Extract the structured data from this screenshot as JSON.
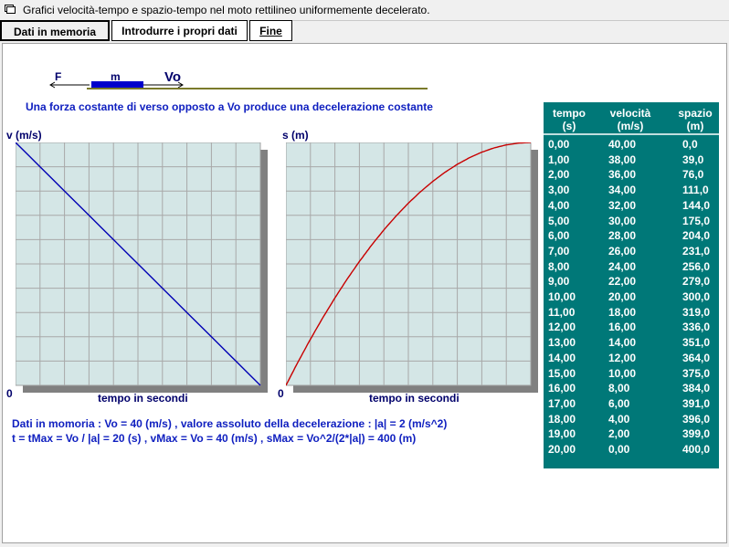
{
  "window": {
    "title": "Grafici velocità-tempo e spazio-tempo nel moto rettilineo uniformemente decelerato."
  },
  "menu": {
    "data_label": "Dati in memoria",
    "input_label": "Introdurre i propri dati",
    "end_label": "Fine"
  },
  "diagram": {
    "force_label": "F",
    "mass_label": "m",
    "velocity_label": "Vo"
  },
  "description": "Una forza costante di verso opposto a Vo produce una decelerazione costante",
  "velocity_chart": {
    "ylabel": "v (m/s)",
    "xlabel": "tempo in secondi",
    "origin": "0"
  },
  "space_chart": {
    "ylabel": "s (m)",
    "xlabel": "tempo in secondi",
    "origin": "0"
  },
  "chart_data": [
    {
      "type": "line",
      "ylabel": "v (m/s)",
      "xlabel": "tempo in secondi",
      "xlim": [
        0,
        20
      ],
      "ylim": [
        0,
        40
      ],
      "grid": true,
      "x": [
        0,
        1,
        2,
        3,
        4,
        5,
        6,
        7,
        8,
        9,
        10,
        11,
        12,
        13,
        14,
        15,
        16,
        17,
        18,
        19,
        20
      ],
      "y": [
        40,
        38,
        36,
        34,
        32,
        30,
        28,
        26,
        24,
        22,
        20,
        18,
        16,
        14,
        12,
        10,
        8,
        6,
        4,
        2,
        0
      ],
      "color": "#0000b4"
    },
    {
      "type": "line",
      "ylabel": "s (m)",
      "xlabel": "tempo in secondi",
      "xlim": [
        0,
        20
      ],
      "ylim": [
        0,
        400
      ],
      "grid": true,
      "x": [
        0,
        1,
        2,
        3,
        4,
        5,
        6,
        7,
        8,
        9,
        10,
        11,
        12,
        13,
        14,
        15,
        16,
        17,
        18,
        19,
        20
      ],
      "y": [
        0,
        39,
        76,
        111,
        144,
        175,
        204,
        231,
        256,
        279,
        300,
        319,
        336,
        351,
        364,
        375,
        384,
        391,
        396,
        399,
        400
      ],
      "color": "#c80000"
    }
  ],
  "table": {
    "headers": [
      [
        "tempo",
        "(s)"
      ],
      [
        "velocità",
        "(m/s)"
      ],
      [
        "spazio",
        "(m)"
      ]
    ],
    "rows": [
      [
        "0,00",
        "40,00",
        "0,0"
      ],
      [
        "1,00",
        "38,00",
        "39,0"
      ],
      [
        "2,00",
        "36,00",
        "76,0"
      ],
      [
        "3,00",
        "34,00",
        "111,0"
      ],
      [
        "4,00",
        "32,00",
        "144,0"
      ],
      [
        "5,00",
        "30,00",
        "175,0"
      ],
      [
        "6,00",
        "28,00",
        "204,0"
      ],
      [
        "7,00",
        "26,00",
        "231,0"
      ],
      [
        "8,00",
        "24,00",
        "256,0"
      ],
      [
        "9,00",
        "22,00",
        "279,0"
      ],
      [
        "10,00",
        "20,00",
        "300,0"
      ],
      [
        "11,00",
        "18,00",
        "319,0"
      ],
      [
        "12,00",
        "16,00",
        "336,0"
      ],
      [
        "13,00",
        "14,00",
        "351,0"
      ],
      [
        "14,00",
        "12,00",
        "364,0"
      ],
      [
        "15,00",
        "10,00",
        "375,0"
      ],
      [
        "16,00",
        "8,00",
        "384,0"
      ],
      [
        "17,00",
        "6,00",
        "391,0"
      ],
      [
        "18,00",
        "4,00",
        "396,0"
      ],
      [
        "19,00",
        "2,00",
        "399,0"
      ],
      [
        "20,00",
        "0,00",
        "400,0"
      ]
    ]
  },
  "info": {
    "line1": "Dati in momoria : Vo = 40 (m/s) , valore assoluto della decelerazione : |a| = 2 (m/s^2)",
    "line2": "t = tMax = Vo / |a| = 20 (s) , vMax = Vo = 40 (m/s) , sMax = Vo^2/(2*|a|) = 400 (m)"
  },
  "colors": {
    "table_bg": "#007878",
    "plot_bg": "#d4e6e6",
    "text_blue": "#1020c0",
    "velocity_line": "#0000b4",
    "space_line": "#c80000"
  }
}
